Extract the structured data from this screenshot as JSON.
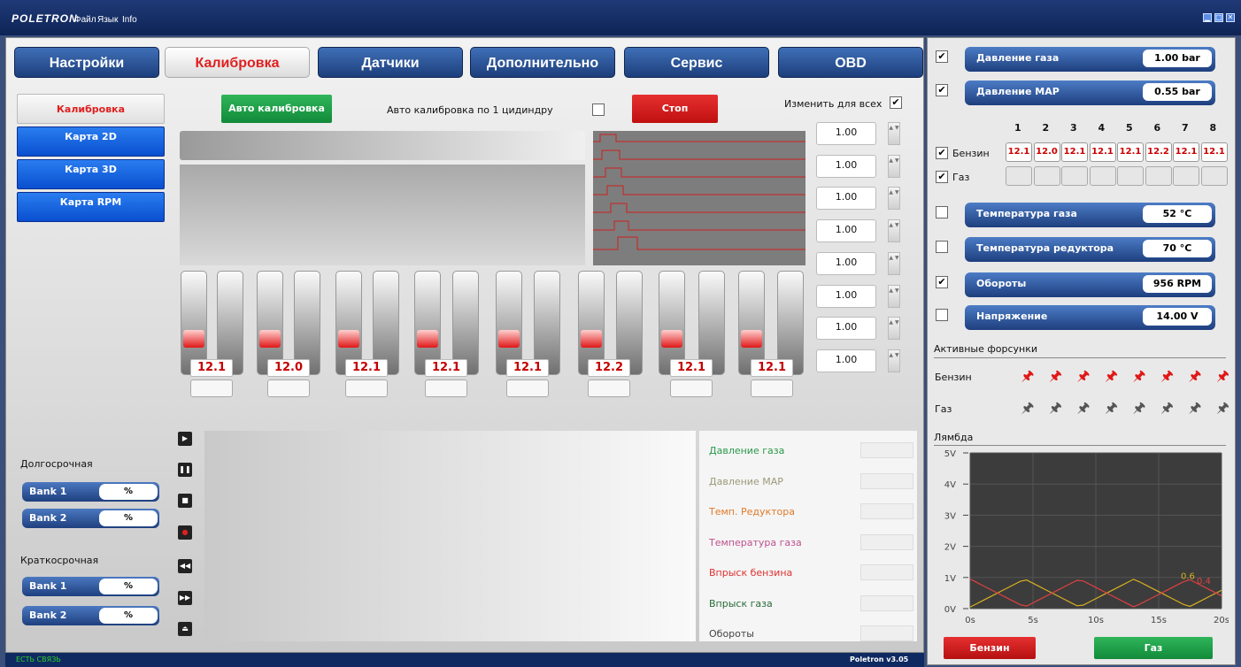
{
  "app": {
    "logo": "POLETRON",
    "menu": [
      "Файл",
      "Язык",
      "Info"
    ],
    "version": "Poletron v3.05",
    "status": "ЕСТЬ СВЯЗЬ"
  },
  "tabs": [
    "Настройки",
    "Калибровка",
    "Датчики",
    "Дополнительно",
    "Сервис",
    "OBD"
  ],
  "sidebar": [
    "Калибровка",
    "Карта 2D",
    "Карта 3D",
    "Карта RPM"
  ],
  "controls": {
    "auto_calib": "Авто калибровка",
    "auto_calib_one": "Авто калибровка по 1 цидиндру",
    "stop": "Стоп",
    "change_all": "Изменить для всех",
    "change_all_checked": "✔"
  },
  "multipliers": [
    "1.00",
    "1.00",
    "1.00",
    "1.00",
    "1.00",
    "1.00",
    "1.00",
    "1.00"
  ],
  "petrol_values": [
    "12.1",
    "12.0",
    "12.1",
    "12.1",
    "12.1",
    "12.2",
    "12.1",
    "12.1"
  ],
  "trims": {
    "long_title": "Долгосрочная",
    "short_title": "Краткосрочная",
    "long": [
      {
        "label": "Bank 1",
        "value": "%"
      },
      {
        "label": "Bank 2",
        "value": "%"
      }
    ],
    "short": [
      {
        "label": "Bank 1",
        "value": "%"
      },
      {
        "label": "Bank 2",
        "value": "%"
      }
    ]
  },
  "legend": [
    {
      "label": "Давление газа",
      "color": "#2a9a4a"
    },
    {
      "label": "Давление MAP",
      "color": "#9a9a7a"
    },
    {
      "label": "Темп. Редуктора",
      "color": "#e07a2a"
    },
    {
      "label": "Температура газа",
      "color": "#c05090"
    },
    {
      "label": "Впрыск бензина",
      "color": "#e03030"
    },
    {
      "label": "Впрыск газа",
      "color": "#2a6a3a"
    },
    {
      "label": "Обороты",
      "color": "#444444"
    }
  ],
  "sensors": [
    {
      "label": "Давление газа",
      "value": "1.00 bar",
      "checked": "✔"
    },
    {
      "label": "Давление MAP",
      "value": "0.55 bar",
      "checked": "✔"
    },
    {
      "label": "Температура газа",
      "value": "52 °C",
      "checked": ""
    },
    {
      "label": "Температура редуктора",
      "value": "70 °C",
      "checked": ""
    },
    {
      "label": "Обороты",
      "value": "956 RPM",
      "checked": "✔"
    },
    {
      "label": "Напряжение",
      "value": "14.00 V",
      "checked": ""
    }
  ],
  "cylinders": [
    "1",
    "2",
    "3",
    "4",
    "5",
    "6",
    "7",
    "8"
  ],
  "cyl_rows": {
    "petrol": "Бензин",
    "gas": "Газ",
    "petrol_checked": "✔",
    "gas_checked": "✔"
  },
  "injectors": {
    "title": "Активные форсунки",
    "petrol": "Бензин",
    "gas": "Газ"
  },
  "lambda": {
    "title": "Лямбда",
    "y_ticks": [
      "5V",
      "4V",
      "3V",
      "2V",
      "1V",
      "0V"
    ],
    "x_ticks": [
      "0s",
      "5s",
      "10s",
      "15s",
      "20s"
    ],
    "label_a": "0.6",
    "label_b": "0.4",
    "btn_petrol": "Бензин",
    "btn_gas": "Газ"
  }
}
